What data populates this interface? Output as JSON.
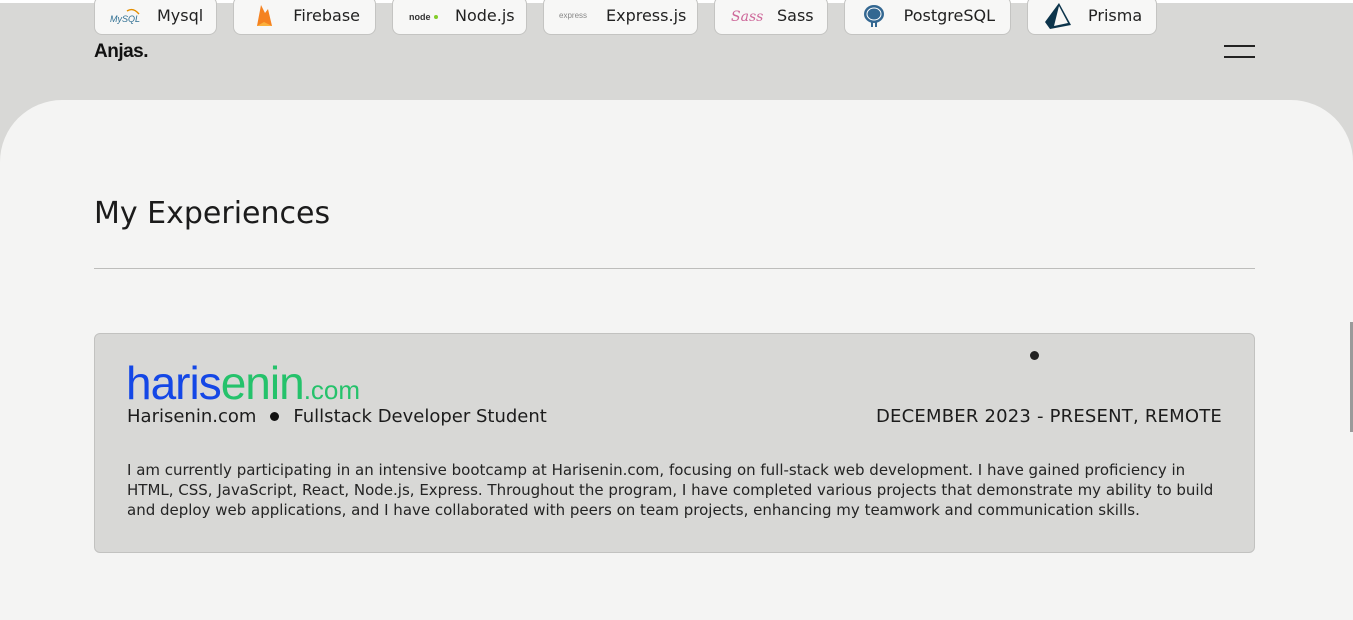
{
  "tech_stack": [
    {
      "label": "Mysql",
      "icon": "mysql-icon",
      "mark": "MySQL"
    },
    {
      "label": "Firebase",
      "icon": "firebase-icon"
    },
    {
      "label": "Node.js",
      "icon": "nodejs-icon",
      "mark": "node"
    },
    {
      "label": "Express.js",
      "icon": "express-icon",
      "mark": "express"
    },
    {
      "label": "Sass",
      "icon": "sass-icon",
      "mark": "Sass"
    },
    {
      "label": "PostgreSQL",
      "icon": "postgresql-icon"
    },
    {
      "label": "Prisma",
      "icon": "prisma-icon"
    }
  ],
  "header": {
    "brand": "Anjas.",
    "menu_icon": "hamburger-menu-icon"
  },
  "section": {
    "title": "My Experiences"
  },
  "experience": {
    "logo_part1": "haris",
    "logo_part2": "enin",
    "logo_part3": ".com",
    "company": "Harisenin.com",
    "role": "Fullstack Developer Student",
    "period": "DECEMBER 2023 - PRESENT, REMOTE",
    "description": "I am currently participating in an intensive bootcamp at Harisenin.com, focusing on full-stack web development. I have gained proficiency in HTML, CSS, JavaScript, React, Node.js, Express. Throughout the program, I have completed various projects that demonstrate my ability to build and deploy web applications, and I have collaborated with peers on team projects, enhancing my teamwork and communication skills."
  },
  "colors": {
    "background": "#d8d8d6",
    "panel": "#f4f4f3",
    "brand_blue": "#1447e6",
    "brand_green": "#25c26b"
  }
}
